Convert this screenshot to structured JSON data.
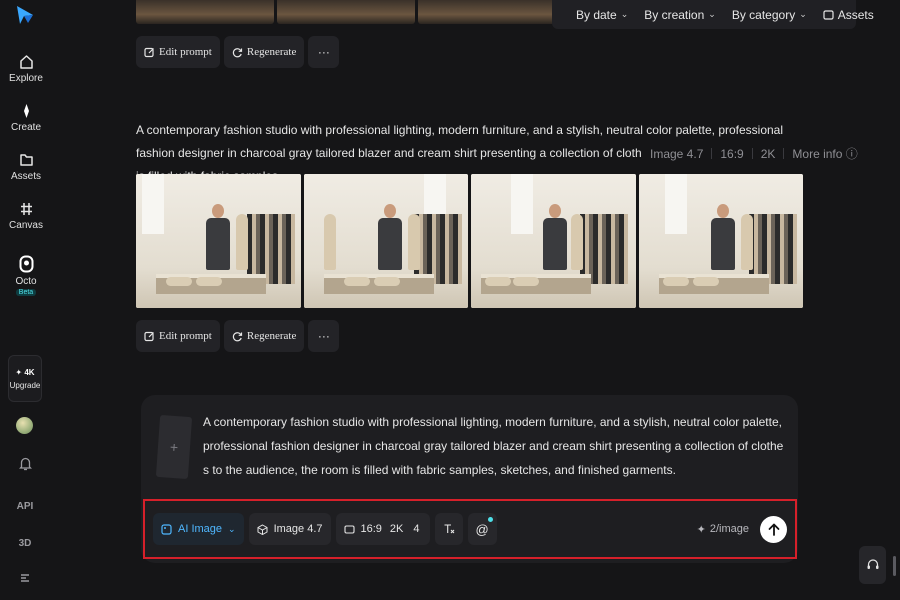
{
  "sidebar": {
    "nav": [
      {
        "label": "Explore",
        "icon": "home-icon"
      },
      {
        "label": "Create",
        "icon": "sparkle-icon"
      },
      {
        "label": "Assets",
        "icon": "folder-icon"
      },
      {
        "label": "Canvas",
        "icon": "hash-grid-icon"
      },
      {
        "label": "Octo",
        "icon": "octo-icon",
        "badge": "Beta"
      }
    ],
    "upgrade": {
      "top": "4K",
      "label": "Upgrade"
    },
    "api_label": "API",
    "three_d_label": "3D"
  },
  "toolbar": {
    "by_date": "By date",
    "by_creation": "By creation",
    "by_category": "By category",
    "assets": "Assets"
  },
  "actions": {
    "edit_prompt": "Edit prompt",
    "regenerate": "Regenerate",
    "more": "···"
  },
  "prompt": {
    "text": "A contemporary fashion studio with professional lighting, modern furniture, and a stylish, neutral color palette, professional fashion designer in charcoal gray tailored blazer and cream shirt presenting a collection of clothes to the audience, the room is filled with fabric samples,",
    "model": "Image 4.7",
    "ratio": "16:9",
    "resolution": "2K",
    "more_info": "More info"
  },
  "composer": {
    "prompt_text": "A contemporary fashion studio with professional lighting, modern furniture, and a stylish, neutral color palette, professional fashion designer in charcoal gray tailored blazer and cream shirt presenting a collection of clothes to the audience, the room is filled with fabric samples, sketches, and finished garments.",
    "mode": "AI Image",
    "model": "Image 4.7",
    "ratio": "16:9",
    "resolution": "2K",
    "count": "4",
    "credits": "2/image"
  },
  "colors": {
    "accent_blue": "#4fb7ff",
    "highlight_border": "#d6202a",
    "background": "#151517"
  }
}
